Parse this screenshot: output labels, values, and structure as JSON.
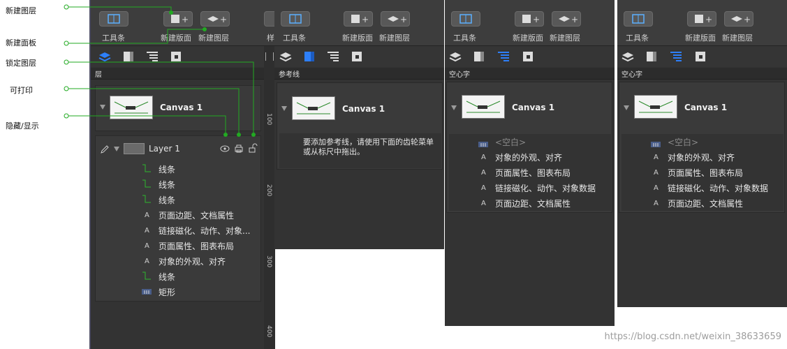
{
  "annotations": [
    "新建图层",
    "新建面板",
    "锁定图层",
    "可打印",
    "隐藏/显示"
  ],
  "toolbar": {
    "tools": "工具条",
    "new_canvas": "新建版面",
    "new_layer": "新建图层",
    "style_cut": "样"
  },
  "panel1": {
    "section_title": "层",
    "canvas_title": "Canvas 1",
    "layer_title": "Layer 1",
    "items": [
      "线条",
      "线条",
      "线条",
      "页面边距、文档属性",
      "链接磁化、动作、对象...",
      "页面属性、图表布局",
      "对象的外观、对齐",
      "线条",
      "矩形"
    ],
    "ruler_ticks": [
      "100",
      "200",
      "300",
      "400"
    ]
  },
  "panel2": {
    "section_title": "参考线",
    "canvas_title": "Canvas 1",
    "hint_line1": "要添加参考线，请使用下面的齿轮菜单",
    "hint_line2": "或从标尺中拖出。"
  },
  "panel3": {
    "section_title": "空心字",
    "canvas_title": "Canvas 1",
    "items": [
      "<空白>",
      "对象的外观、对齐",
      "页面属性、图表布局",
      "链接磁化、动作、对象数据",
      "页面边距、文档属性"
    ]
  },
  "panel4": {
    "section_title": "空心字",
    "canvas_title": "Canvas 1",
    "items": [
      "<空白>",
      "对象的外观、对齐",
      "页面属性、图表布局",
      "链接磁化、动作、对象数据",
      "页面边距、文档属性"
    ]
  },
  "watermark": "https://blog.csdn.net/weixin_38633659",
  "colors": {
    "accent": "#2d7ff9",
    "callout": "#22aa22",
    "panel": "#333333"
  }
}
